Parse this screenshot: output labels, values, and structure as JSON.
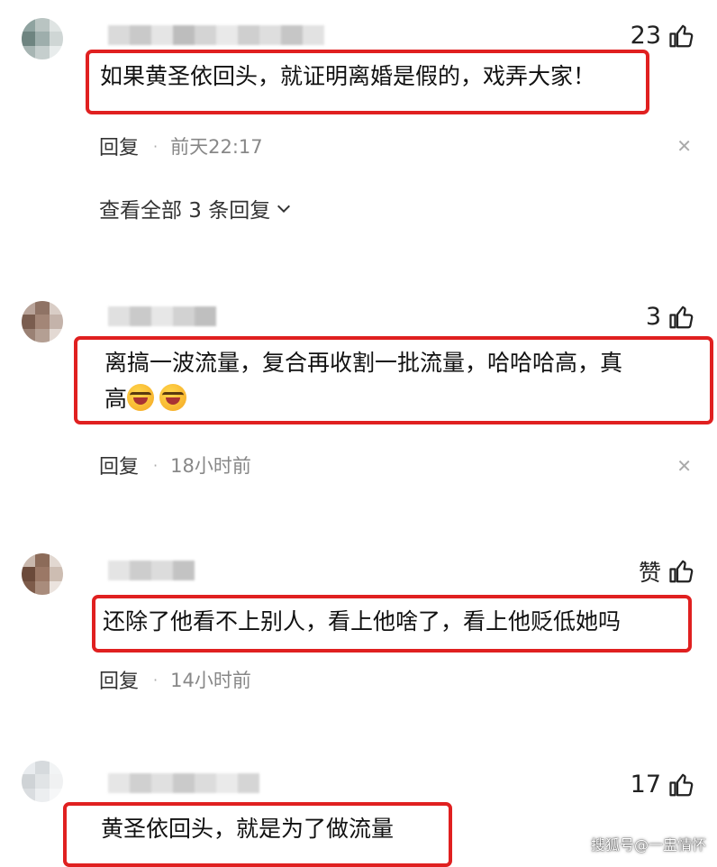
{
  "comments": [
    {
      "likes": "23",
      "text": "如果黄圣依回头，就证明离婚是假的，戏弄大家！",
      "reply_label": "回复",
      "time": "前天22:17",
      "view_all": "查看全部 3 条回复"
    },
    {
      "likes": "3",
      "text_line1": "离搞一波流量，复合再收割一批流量，哈哈哈高，真",
      "text_line2": "高",
      "reply_label": "回复",
      "time": "18小时前"
    },
    {
      "likes": "赞",
      "text": "还除了他看不上别人，看上他啥了，看上他贬低她吗",
      "reply_label": "回复",
      "time": "14小时前"
    },
    {
      "likes": "17",
      "text": "黄圣依回头，就是为了做流量"
    }
  ],
  "watermark": "搜狐号@一盅情怀",
  "colors": {
    "highlight_border": "#e02020",
    "meta_gray": "#888888"
  }
}
